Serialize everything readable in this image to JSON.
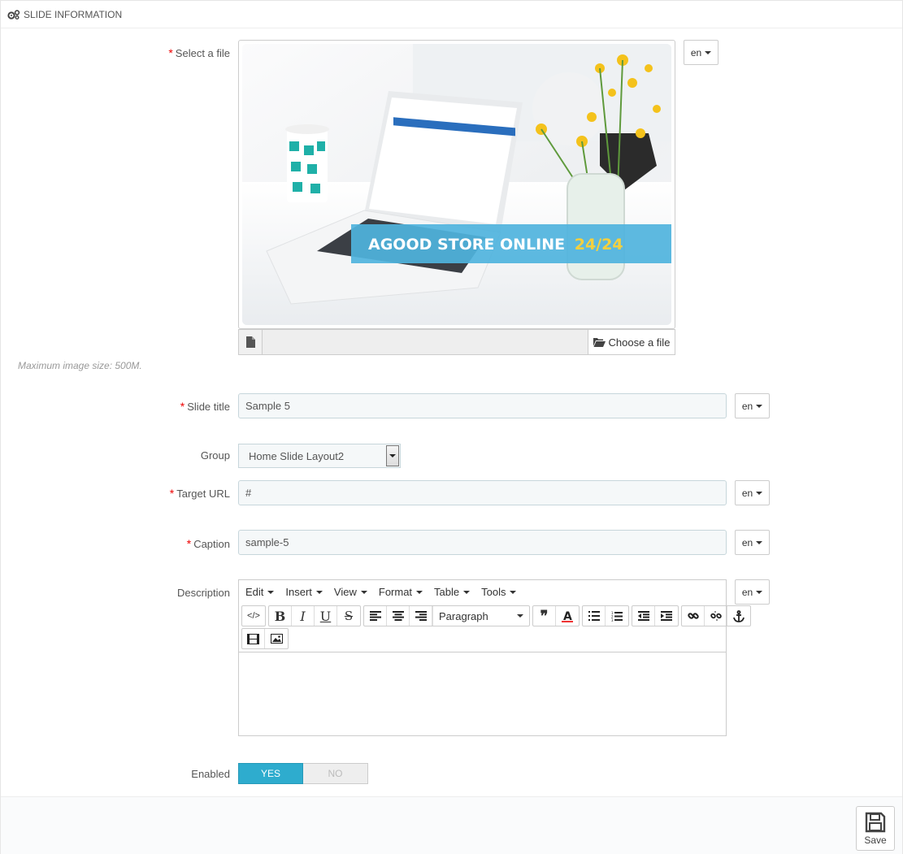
{
  "panel": {
    "title": "SLIDE INFORMATION",
    "icon": "cogs-icon"
  },
  "file": {
    "label": "Select a file",
    "lang": "en",
    "choose_label": "Choose a file",
    "hint": "Maximum image size: 500M.",
    "banner_text": "AGOOD STORE ONLINE",
    "banner_highlight": "24/24"
  },
  "slide_title": {
    "label": "Slide title",
    "value": "Sample 5",
    "lang": "en"
  },
  "group": {
    "label": "Group",
    "value": "Home Slide Layout2"
  },
  "target_url": {
    "label": "Target URL",
    "value": "#",
    "lang": "en"
  },
  "caption": {
    "label": "Caption",
    "value": "sample-5",
    "lang": "en"
  },
  "description": {
    "label": "Description",
    "lang": "en",
    "menus": [
      "Edit",
      "Insert",
      "View",
      "Format",
      "Table",
      "Tools"
    ],
    "format_select": "Paragraph"
  },
  "enabled": {
    "label": "Enabled",
    "yes": "YES",
    "no": "NO",
    "value": true
  },
  "footer": {
    "save_label": "Save"
  },
  "colors": {
    "accent": "#2eacce",
    "required": "#ee0000",
    "banner": "#4fb3dd",
    "banner_highlight": "#f4d03f"
  }
}
